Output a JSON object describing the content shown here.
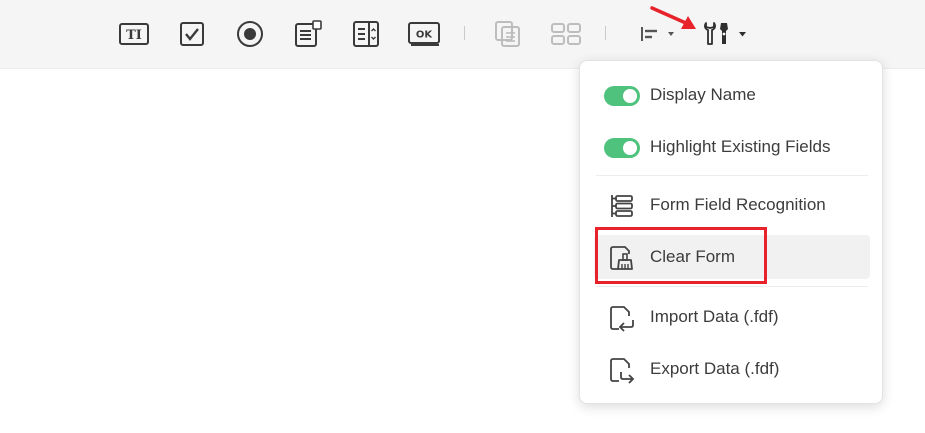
{
  "toolbar": {
    "tools": [
      {
        "name": "text-field",
        "icon": "text-field-icon"
      },
      {
        "name": "checkbox",
        "icon": "checkbox-icon"
      },
      {
        "name": "radio-button",
        "icon": "radio-button-icon"
      },
      {
        "name": "list-box",
        "icon": "list-box-icon"
      },
      {
        "name": "combo-box",
        "icon": "combo-box-icon"
      },
      {
        "name": "push-button",
        "icon": "push-button-icon",
        "text": "OK"
      }
    ],
    "disabled_tools": [
      "duplicate-icon",
      "grid-arrange-icon"
    ],
    "align_icon": "align-left-icon",
    "tools_icon": "form-tools-icon",
    "text_tool_glyph": "TI"
  },
  "menu": {
    "toggles": [
      {
        "label": "Display Name",
        "on": true
      },
      {
        "label": "Highlight Existing Fields",
        "on": true
      }
    ],
    "actions_group1": [
      {
        "label": "Form Field Recognition",
        "icon": "form-recognition-icon"
      },
      {
        "label": "Clear Form",
        "icon": "clear-form-icon"
      }
    ],
    "actions_group2": [
      {
        "label": "Import Data (.fdf)",
        "icon": "import-data-icon"
      },
      {
        "label": "Export Data (.fdf)",
        "icon": "export-data-icon"
      }
    ]
  },
  "colors": {
    "toggle_on": "#4fc27d",
    "annotation_red": "#e8222a",
    "toolbar_bg": "#f5f5f5"
  }
}
